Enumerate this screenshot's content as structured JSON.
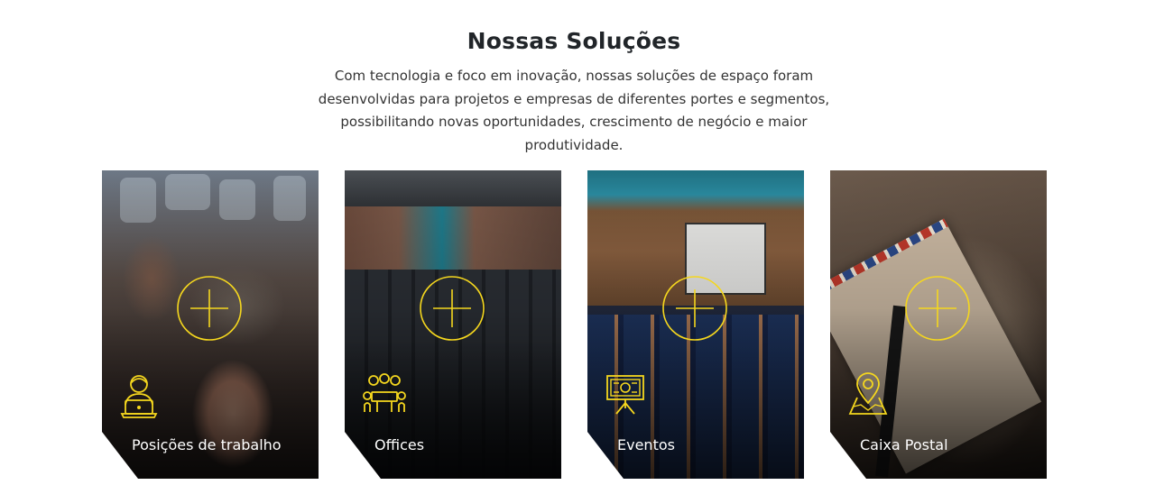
{
  "section": {
    "title": "Nossas Soluções",
    "description": "Com tecnologia e foco em inovação, nossas soluções de espaço foram desenvolvidas para projetos e empresas de diferentes portes e segmentos, possibilitando novas oportunidades, crescimento de negócio e maior produtividade."
  },
  "cards": [
    {
      "label": "Posições de trabalho",
      "icon": "person-laptop-icon",
      "action_icon": "plus-circle-icon"
    },
    {
      "label": "Offices",
      "icon": "team-meeting-icon",
      "action_icon": "plus-circle-icon"
    },
    {
      "label": "Eventos",
      "icon": "presentation-board-icon",
      "action_icon": "plus-circle-icon"
    },
    {
      "label": "Caixa Postal",
      "icon": "map-pin-icon",
      "action_icon": "plus-circle-icon"
    }
  ],
  "colors": {
    "accent": "#f5d71e",
    "heading": "#212529",
    "text": "#333333",
    "card_label": "#ffffff"
  }
}
